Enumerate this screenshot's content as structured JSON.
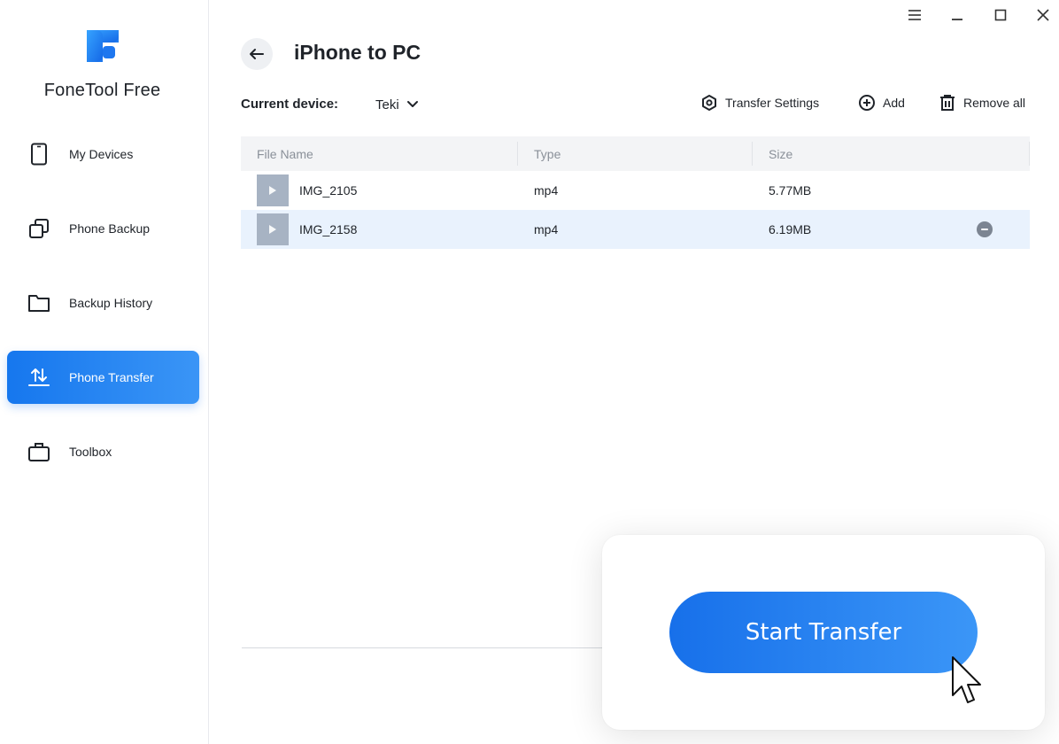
{
  "app": {
    "name": "FoneTool Free",
    "accent": "#1f7ef0"
  },
  "sidebar": {
    "items": [
      {
        "label": "My Devices",
        "icon": "phone-icon",
        "active": false
      },
      {
        "label": "Phone Backup",
        "icon": "copy-icon",
        "active": false
      },
      {
        "label": "Backup History",
        "icon": "folder-icon",
        "active": false
      },
      {
        "label": "Phone Transfer",
        "icon": "transfer-icon",
        "active": true
      },
      {
        "label": "Toolbox",
        "icon": "briefcase-icon",
        "active": false
      }
    ]
  },
  "window_controls": [
    "menu-icon",
    "minimize-icon",
    "maximize-icon",
    "close-icon"
  ],
  "header": {
    "title": "iPhone to PC"
  },
  "device": {
    "label": "Current device:",
    "value": "Teki"
  },
  "toolbar": {
    "transfer_settings": "Transfer Settings",
    "add": "Add",
    "remove_all": "Remove all"
  },
  "table": {
    "columns": [
      "File Name",
      "Type",
      "Size"
    ],
    "rows": [
      {
        "name": "IMG_2105",
        "type": "mp4",
        "size": "5.77MB",
        "selected": false
      },
      {
        "name": "IMG_2158",
        "type": "mp4",
        "size": "6.19MB",
        "selected": true
      }
    ]
  },
  "action": {
    "start_label": "Start Transfer"
  }
}
